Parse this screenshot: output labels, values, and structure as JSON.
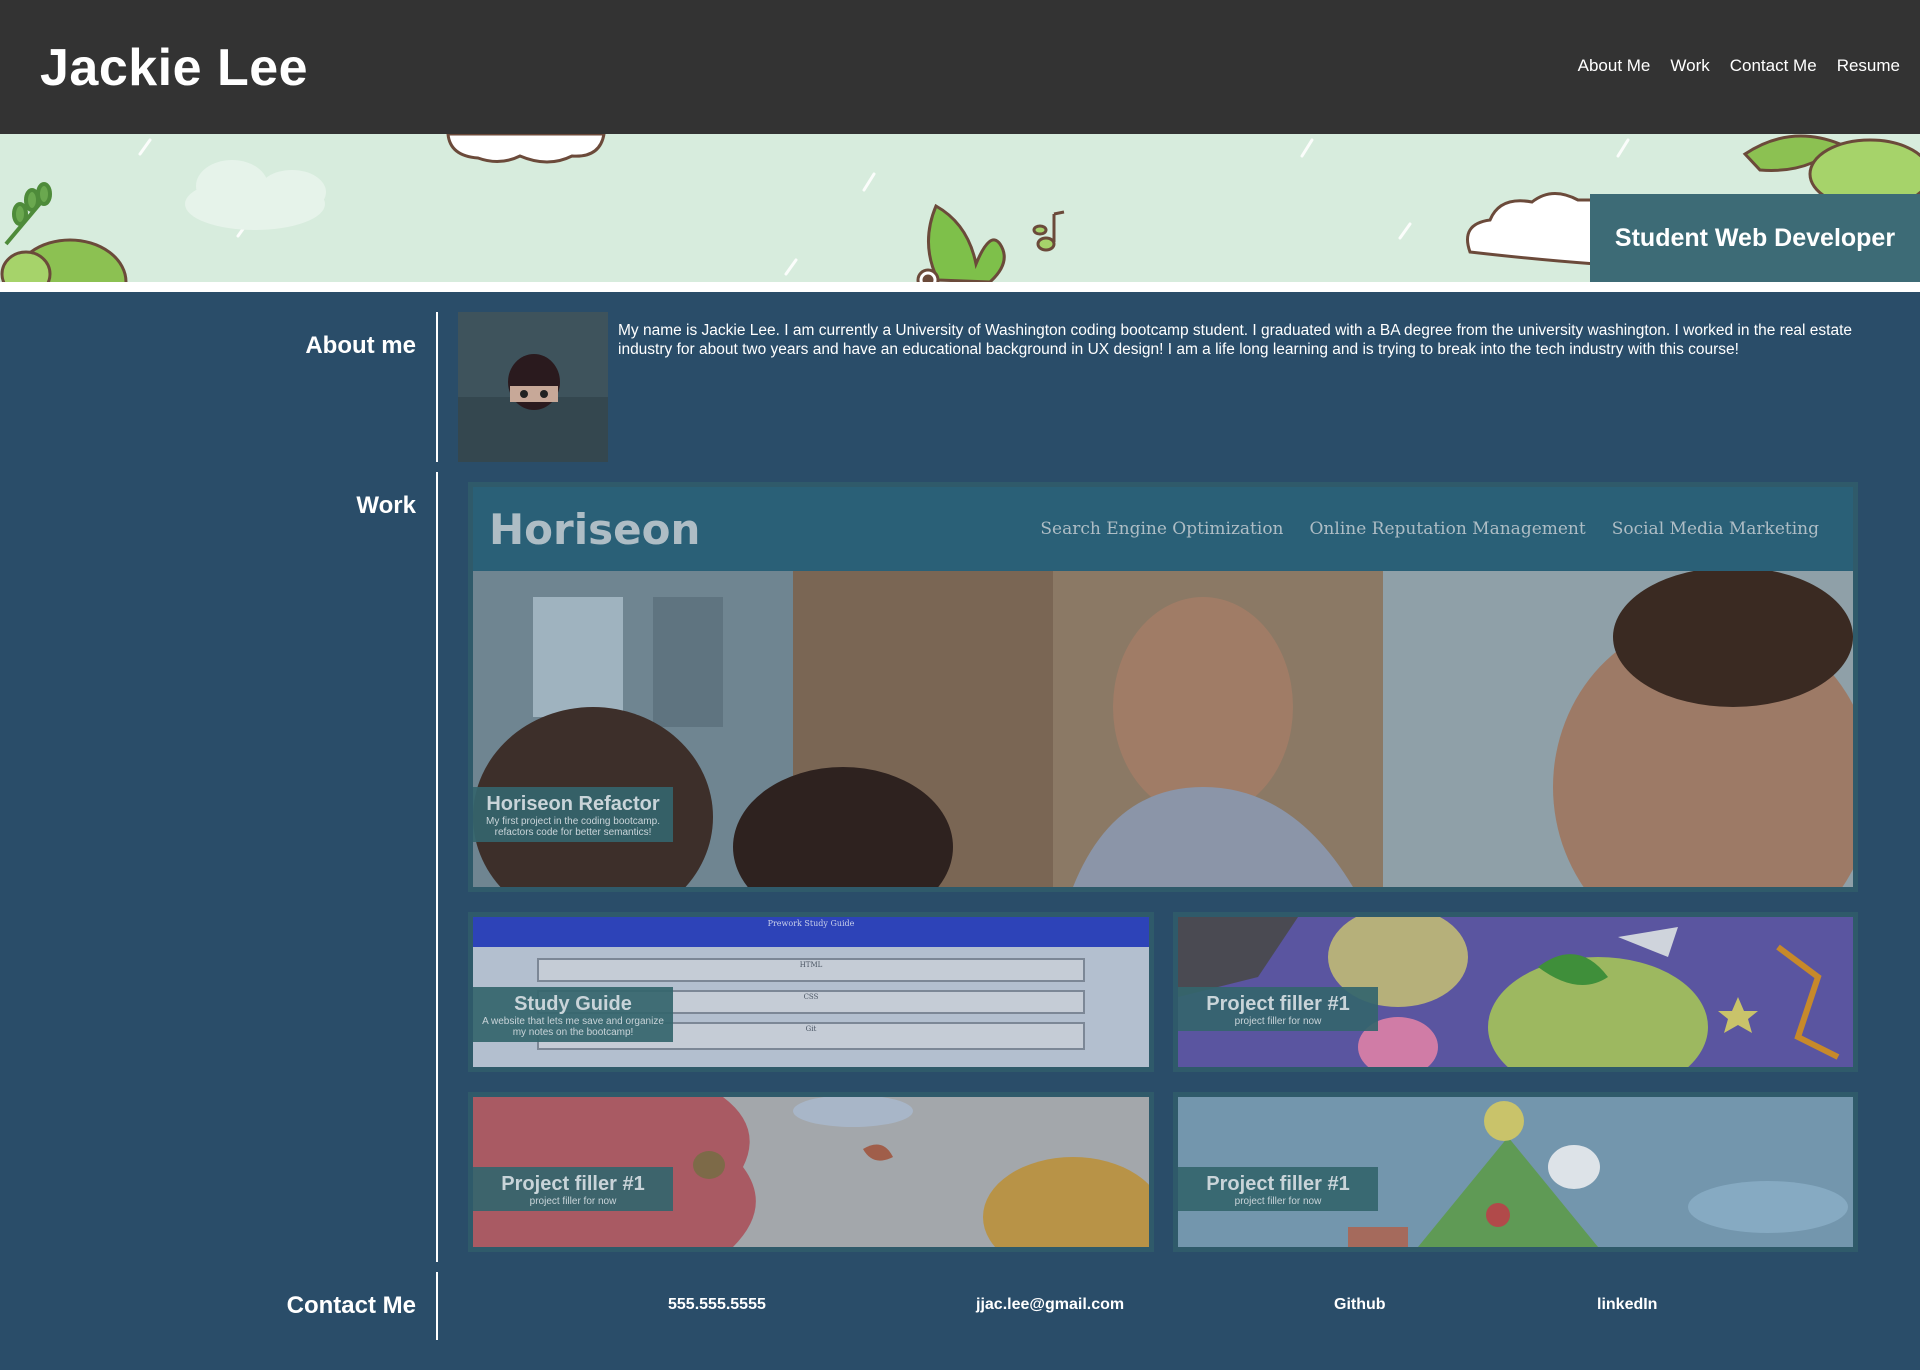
{
  "header": {
    "title": "Jackie Lee",
    "nav": [
      "About Me",
      "Work",
      "Contact Me",
      "Resume"
    ]
  },
  "hero": {
    "badge": "Student Web Developer"
  },
  "about": {
    "heading": "About me",
    "text": "My name is Jackie Lee. I am currently a University of Washington coding bootcamp student. I graduated with a BA degree from the university washington. I worked in the real estate industry for about two years and have an educational background in UX design! I am a life long learning and is trying to break into the tech industry with this course!"
  },
  "work": {
    "heading": "Work",
    "featured": {
      "preview_logo": "Horiseon",
      "preview_links": [
        "Search Engine Optimization",
        "Online Reputation Management",
        "Social Media Marketing"
      ],
      "title": "Horiseon Refactor",
      "desc": "My first project in the coding bootcamp. refactors code for better semantics!"
    },
    "projects": [
      {
        "title": "Study Guide",
        "desc": "A website that lets me save and organize my notes on the bootcamp!",
        "preview_heading": "Prework Study Guide",
        "preview_sections": [
          "HTML",
          "CSS",
          "Git"
        ]
      },
      {
        "title": "Project filler #1",
        "desc": "project filler for now"
      },
      {
        "title": "Project filler #1",
        "desc": "project filler for now"
      },
      {
        "title": "Project filler #1",
        "desc": "project filler for now"
      }
    ]
  },
  "contact": {
    "heading": "Contact Me",
    "items": [
      "555.555.5555",
      "jjac.lee@gmail.com",
      "Github",
      "linkedIn"
    ]
  },
  "colors": {
    "header_bg": "#333333",
    "page_bg": "#2a4d69",
    "accent": "#3d6b76"
  }
}
